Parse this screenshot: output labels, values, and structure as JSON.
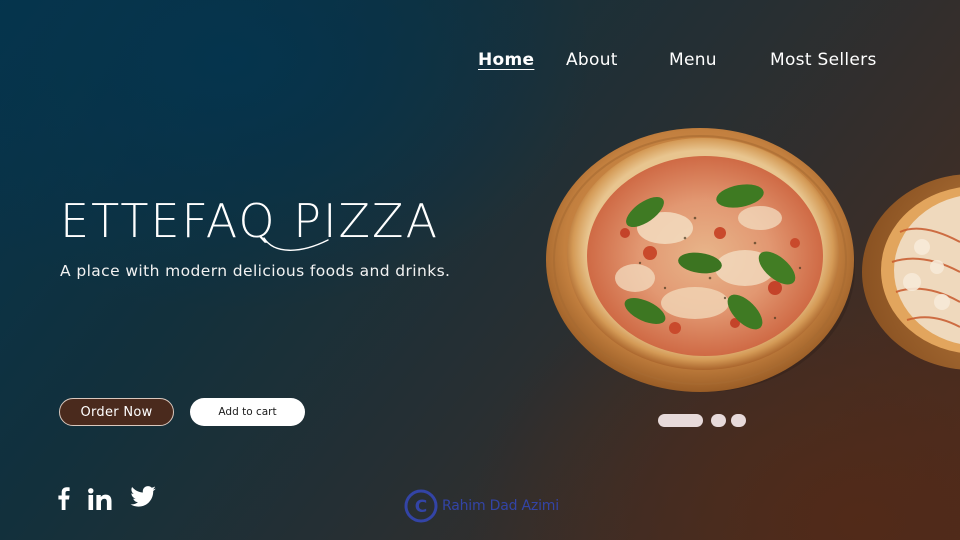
{
  "nav": {
    "items": [
      {
        "label": "Home",
        "active": true
      },
      {
        "label": "About",
        "active": false
      },
      {
        "label": "Menu",
        "active": false
      },
      {
        "label": "Most Sellers",
        "active": false
      }
    ]
  },
  "hero": {
    "title": "ETTEFAQ PIZZA",
    "subtitle": "A place with modern delicious foods and drinks."
  },
  "buttons": {
    "order_label": "Order Now",
    "cart_label": "Add to cart"
  },
  "social": {
    "icons": [
      "facebook-icon",
      "linkedin-icon",
      "twitter-icon"
    ]
  },
  "watermark": {
    "symbol": "C",
    "text": "Rahim Dad Azimi"
  },
  "carousel": {
    "slide_count": 3,
    "active_index": 0
  },
  "colors": {
    "bg_teal": "#05344c",
    "bg_brown": "#4d2c1f",
    "order_button": "#4a2a1d",
    "cart_button": "#ffffff",
    "dots": "#e7dada",
    "watermark": "#3344a6"
  }
}
